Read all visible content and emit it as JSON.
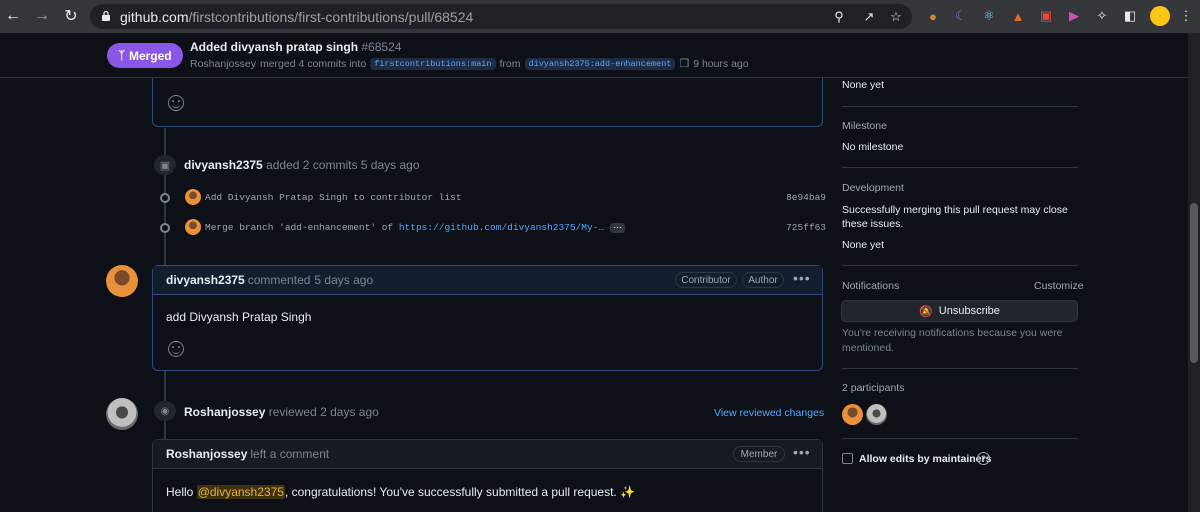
{
  "browser": {
    "url_domain": "github.com",
    "url_path": "/firstcontributions/first-contributions/pull/68524",
    "colors": {
      "profile": "#f9c513"
    }
  },
  "pr": {
    "state": "Merged",
    "title": "Added divyansh pratap singh",
    "number": "#68524",
    "merger": "Roshanjossey",
    "merge_text": "merged 4 commits into",
    "base_branch": "firstcontributions:main",
    "from_text": "from",
    "head_branch": "divyansh2375:add-enhancement",
    "time_ago": "9 hours ago",
    "colors": {
      "merged": "#8957e5"
    }
  },
  "timeline": {
    "commits_event": {
      "author": "divyansh2375",
      "text": "added 2 commits",
      "time": "5 days ago",
      "commits": [
        {
          "message": "Add Divyansh Pratap Singh to contributor list",
          "sha": "8e94ba9"
        },
        {
          "message_prefix": "Merge branch 'add-enhancement' of ",
          "message_link": "https://github.com/divyansh2375/My-…",
          "sha": "725ff63"
        }
      ]
    },
    "comment": {
      "author": "divyansh2375",
      "action": "commented",
      "time": "5 days ago",
      "labels": [
        "Contributor",
        "Author"
      ],
      "body": "add Divyansh Pratap Singh"
    },
    "review": {
      "author": "Roshanjossey",
      "action": "reviewed",
      "time": "2 days ago",
      "link": "View reviewed changes"
    },
    "review_comment": {
      "author": "Roshanjossey",
      "action": "left a comment",
      "label": "Member",
      "body_prefix": "Hello ",
      "mention": "@divyansh2375",
      "body_suffix": ", congratulations! You've successfully submitted a pull request. ✨"
    }
  },
  "sidebar": {
    "linked_value": "None yet",
    "milestone_heading": "Milestone",
    "milestone_value": "No milestone",
    "development_heading": "Development",
    "development_text": "Successfully merging this pull request may close these issues.",
    "development_value": "None yet",
    "notifications_heading": "Notifications",
    "customize": "Customize",
    "unsubscribe": "Unsubscribe",
    "notification_reason": "You're receiving notifications because you were mentioned.",
    "participants_heading": "2 participants",
    "allow_edits": "Allow edits by maintainers"
  }
}
